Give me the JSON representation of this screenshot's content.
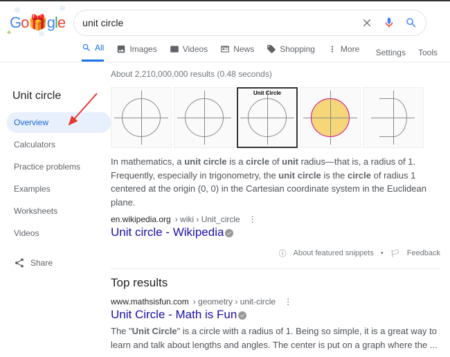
{
  "search": {
    "query": "unit circle"
  },
  "tabs": [
    {
      "label": "All",
      "icon": "search"
    },
    {
      "label": "Images",
      "icon": "image"
    },
    {
      "label": "Videos",
      "icon": "video"
    },
    {
      "label": "News",
      "icon": "news"
    },
    {
      "label": "Shopping",
      "icon": "tag"
    },
    {
      "label": "More",
      "icon": "dots"
    }
  ],
  "tools": {
    "settings": "Settings",
    "tools": "Tools"
  },
  "stats": "About 2,210,000,000 results (0.48 seconds)",
  "side": {
    "title": "Unit circle",
    "items": [
      "Overview",
      "Calculators",
      "Practice problems",
      "Examples",
      "Worksheets",
      "Videos"
    ],
    "share": "Share"
  },
  "thumbs": {
    "unit_label": "Unit Circle"
  },
  "snippet": {
    "p1a": "In mathematics, a ",
    "p1b": "unit circle",
    "p1c": " is a ",
    "p1d": "circle",
    "p1e": " of ",
    "p1f": "unit",
    "p1g": " radius—that is, a radius of 1. Frequently, especially in trigonometry, the ",
    "p1h": "unit circle",
    "p1i": " is the ",
    "p1j": "circle",
    "p1k": " of radius 1 centered at the origin (0, 0) in the Cartesian coordinate system in the Euclidean plane."
  },
  "result1": {
    "cite_host": "en.wikipedia.org",
    "cite_path": " › wiki › Unit_circle",
    "title": "Unit circle - Wikipedia"
  },
  "feedback": {
    "about": "About featured snippets",
    "fb": "Feedback"
  },
  "top": {
    "heading": "Top results"
  },
  "result2": {
    "cite_host": "www.mathsisfun.com",
    "cite_path": " › geometry › unit-circle",
    "title": "Unit Circle - Math is Fun",
    "snip_a": "The \"",
    "snip_b": "Unit Circle",
    "snip_c": "\" is a circle with a radius of 1. Being so simple, it is a great way to learn and talk about lengths and angles. The center is put on a graph where the ..."
  }
}
